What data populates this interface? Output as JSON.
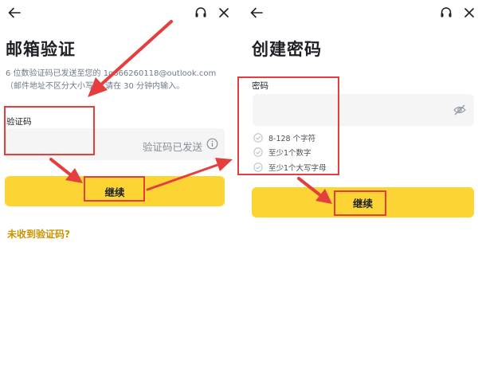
{
  "left_screen": {
    "title": "邮箱验证",
    "description_line1": "6 位数验证码已发送至您的 1o666260118@outlook.com",
    "description_line2": "（邮件地址不区分大小写）。请在 30 分钟内输入。",
    "code_field_label": "验证码",
    "code_status_text": "验证码已发送",
    "continue_label": "继续",
    "resend_link": "未收到验证码?",
    "icons": {
      "back": "arrow-left-icon",
      "support": "headset-icon",
      "close": "close-icon",
      "info": "info-circle-icon"
    }
  },
  "right_screen": {
    "title": "创建密码",
    "password_field_label": "密码",
    "requirements": [
      "8-128 个字符",
      "至少1个数字",
      "至少1个大写字母"
    ],
    "continue_label": "继续",
    "icons": {
      "back": "arrow-left-icon",
      "support": "headset-icon",
      "close": "close-icon",
      "visibility": "eye-off-icon",
      "check": "check-circle-icon"
    }
  },
  "colors": {
    "accent_yellow": "#fcd535",
    "link_gold": "#c99400",
    "annotation_red": "#e53e3e",
    "input_bg": "#f5f5f5"
  }
}
